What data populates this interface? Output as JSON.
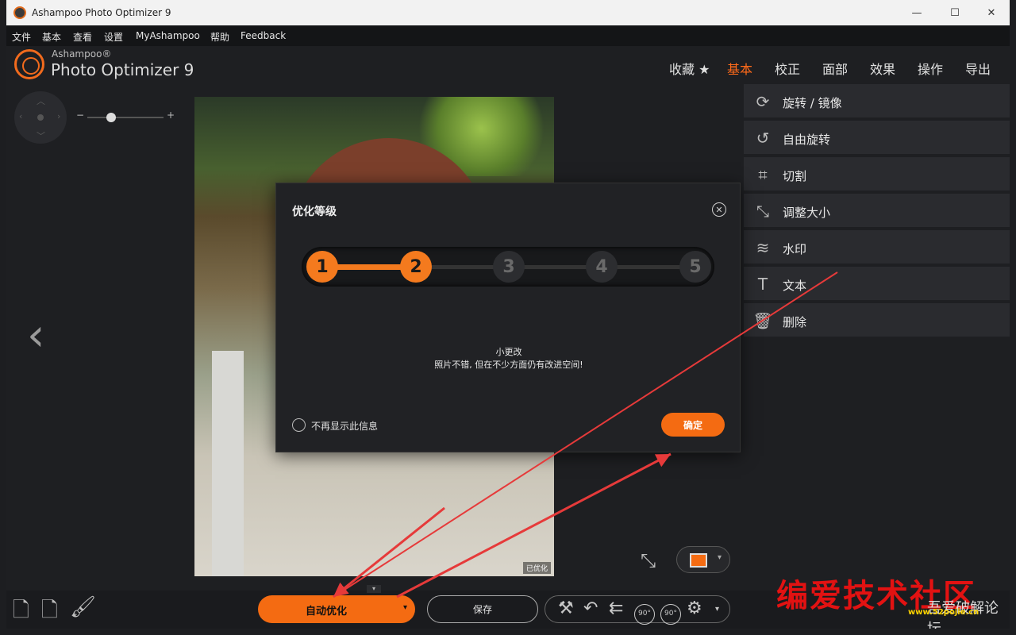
{
  "window": {
    "title": "Ashampoo Photo Optimizer 9",
    "minimize": "—",
    "maximize": "☐",
    "close": "✕"
  },
  "menu": [
    "文件",
    "基本",
    "查看",
    "设置",
    "MyAshampoo",
    "帮助",
    "Feedback"
  ],
  "brand": {
    "top": "Ashampoo®",
    "main": "Photo Optimizer 9"
  },
  "nav_tabs": [
    {
      "label": "收藏 ★",
      "active": false
    },
    {
      "label": "基本",
      "active": true
    },
    {
      "label": "校正",
      "active": false
    },
    {
      "label": "面部",
      "active": false
    },
    {
      "label": "效果",
      "active": false
    },
    {
      "label": "操作",
      "active": false
    },
    {
      "label": "导出",
      "active": false
    }
  ],
  "zoom": {
    "minus": "−",
    "plus": "+"
  },
  "photo": {
    "badge": "已优化"
  },
  "tools": [
    {
      "label": "旋转 / 镜像",
      "icon": "rotate-mirror-icon",
      "glyph": "⟳"
    },
    {
      "label": "自由旋转",
      "icon": "free-rotate-icon",
      "glyph": "↺"
    },
    {
      "label": "切割",
      "icon": "crop-icon",
      "glyph": "⌗"
    },
    {
      "label": "调整大小",
      "icon": "resize-icon",
      "glyph": "⤡"
    },
    {
      "label": "水印",
      "icon": "watermark-icon",
      "glyph": "≋"
    },
    {
      "label": "文本",
      "icon": "text-icon",
      "glyph": "T"
    },
    {
      "label": "删除",
      "icon": "trash-icon",
      "glyph": "🗑"
    }
  ],
  "dialog": {
    "title": "优化等级",
    "steps": [
      "1",
      "2",
      "3",
      "4",
      "5"
    ],
    "selected_step": 2,
    "desc_title": "小更改",
    "desc_text": "照片不错, 但在不少方面仍有改进空间!",
    "dont_show": "不再显示此信息",
    "ok": "确定"
  },
  "bottom": {
    "auto": "自动优化",
    "save": "保存",
    "rotate_left_label": "90°",
    "rotate_right_label": "90°"
  },
  "watermark": {
    "main": "编爱技术社区",
    "url": "www.52pojie.cn",
    "sub": "吾爱破解论坛"
  },
  "colors": {
    "accent": "#f46b12",
    "arrow": "#e63a3a"
  }
}
